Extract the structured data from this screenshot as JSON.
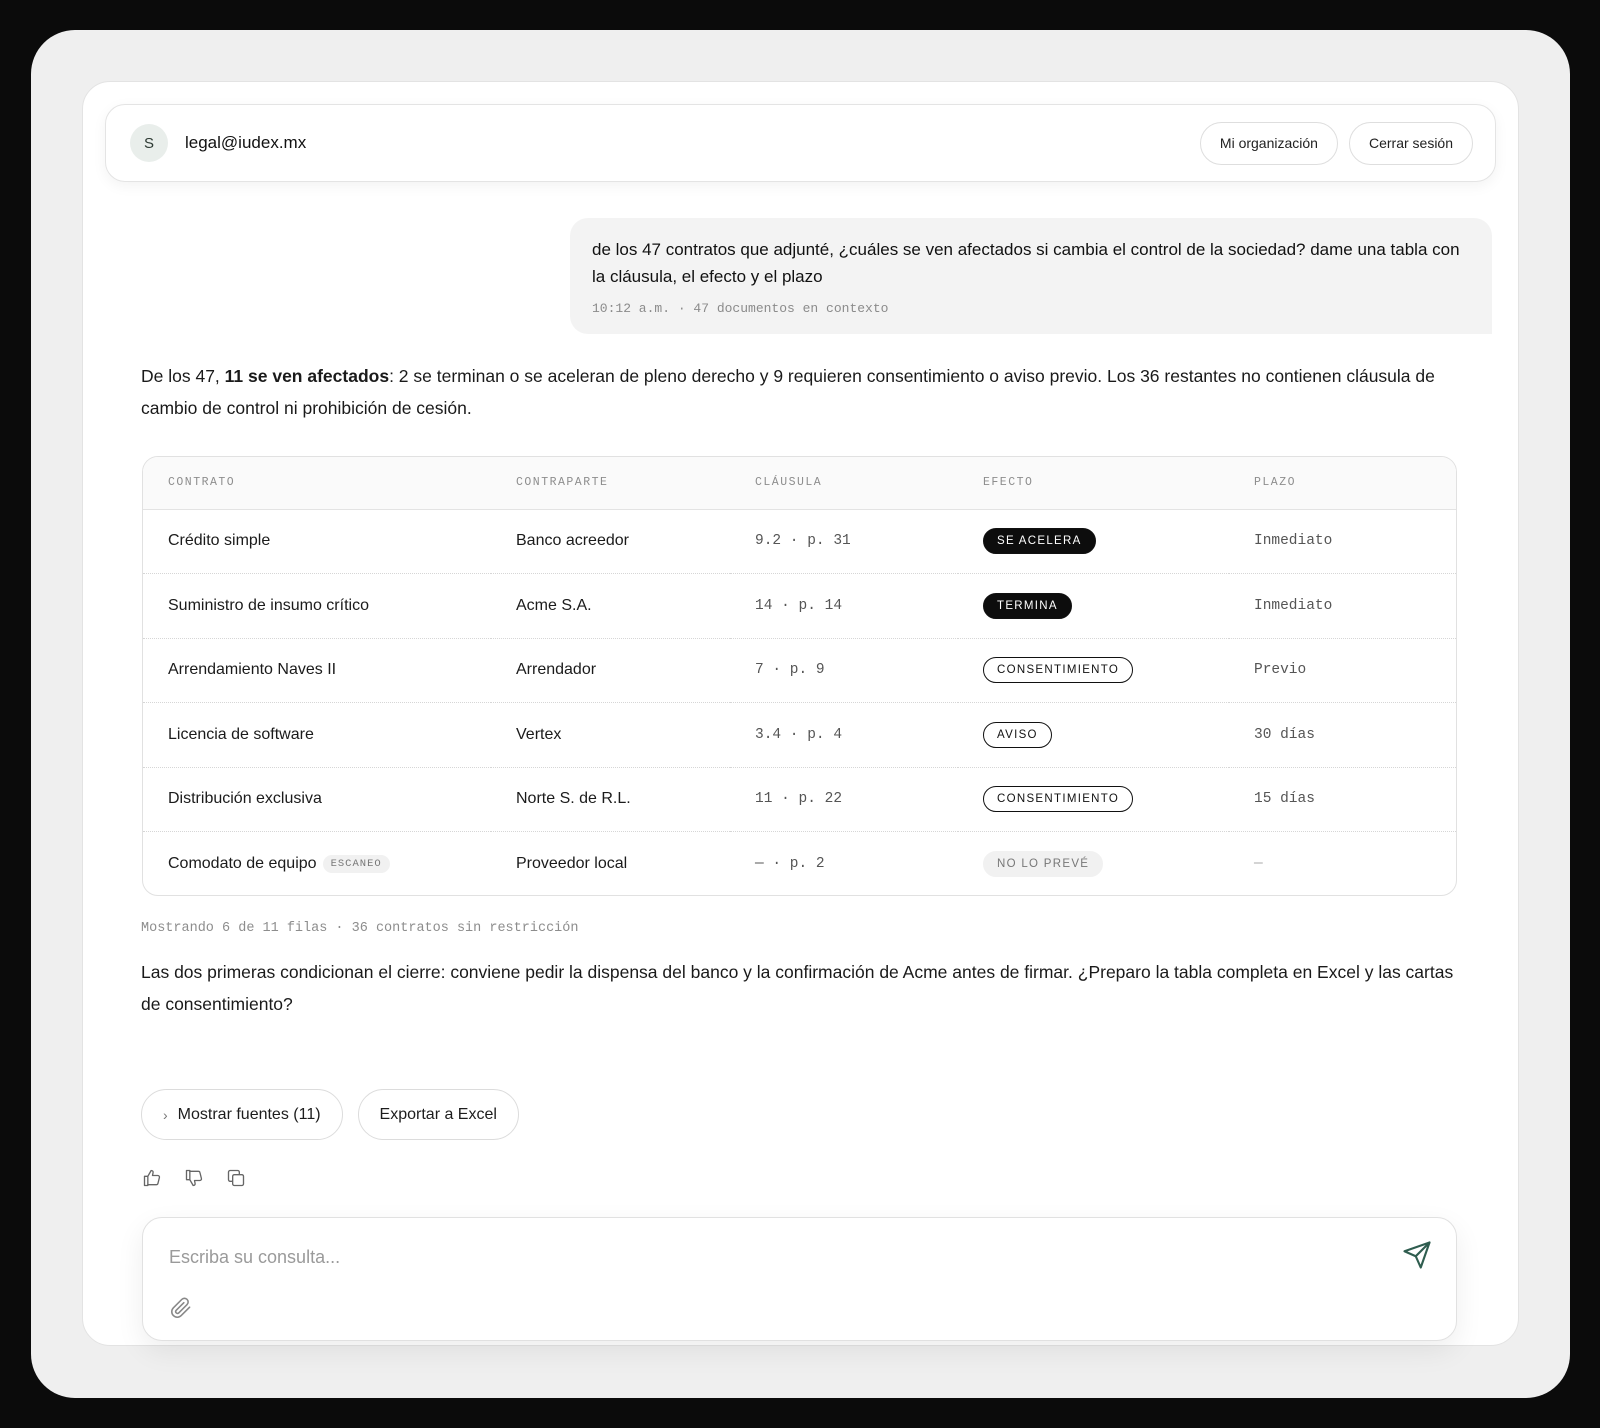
{
  "header": {
    "avatar_initial": "S",
    "email": "legal@iudex.mx",
    "org_button": "Mi organización",
    "logout_button": "Cerrar sesión"
  },
  "user_message": {
    "text": "de los 47 contratos que adjunté, ¿cuáles se ven afectados si cambia el control de la sociedad? dame una tabla con la cláusula, el efecto y el plazo",
    "meta": "10:12 a.m. · 47 documentos en contexto"
  },
  "assistant": {
    "intro_pre": "De los 47, ",
    "intro_bold": "11 se ven afectados",
    "intro_post": ": 2 se terminan o se aceleran de pleno derecho y 9 requieren consentimiento o aviso previo. Los 36 restantes no contienen cláusula de cambio de control ni prohibición de cesión.",
    "table": {
      "headers": [
        "CONTRATO",
        "CONTRAPARTE",
        "CLÁUSULA",
        "EFECTO",
        "PLAZO"
      ],
      "rows": [
        {
          "contrato": "Crédito simple",
          "tag": "",
          "contraparte": "Banco acreedor",
          "clausula": "9.2 · p. 31",
          "efecto": "SE ACELERA",
          "efecto_style": "solid",
          "plazo": "Inmediato"
        },
        {
          "contrato": "Suministro de insumo crítico",
          "tag": "",
          "contraparte": "Acme S.A.",
          "clausula": "14 · p. 14",
          "efecto": "TERMINA",
          "efecto_style": "solid",
          "plazo": "Inmediato"
        },
        {
          "contrato": "Arrendamiento Naves II",
          "tag": "",
          "contraparte": "Arrendador",
          "clausula": "7 · p. 9",
          "efecto": "CONSENTIMIENTO",
          "efecto_style": "outline",
          "plazo": "Previo"
        },
        {
          "contrato": "Licencia de software",
          "tag": "",
          "contraparte": "Vertex",
          "clausula": "3.4 · p. 4",
          "efecto": "AVISO",
          "efecto_style": "outline",
          "plazo": "30 días"
        },
        {
          "contrato": "Distribución exclusiva",
          "tag": "",
          "contraparte": "Norte S. de R.L.",
          "clausula": "11 · p. 22",
          "efecto": "CONSENTIMIENTO",
          "efecto_style": "outline",
          "plazo": "15 días"
        },
        {
          "contrato": "Comodato de equipo",
          "tag": "ESCANEO",
          "contraparte": "Proveedor local",
          "clausula": "— · p. 2",
          "efecto": "NO LO PREVÉ",
          "efecto_style": "muted",
          "plazo": "—"
        }
      ],
      "note": "Mostrando 6 de 11 filas · 36 contratos sin restricción"
    },
    "closing": "Las dos primeras condicionan el cierre: conviene pedir la dispensa del banco y la confirmación de Acme antes de firmar. ¿Preparo la tabla completa en Excel y las cartas de consentimiento?",
    "sources_button": "Mostrar fuentes (11)",
    "export_button": "Exportar a Excel"
  },
  "composer": {
    "placeholder": "Escriba su consulta...",
    "value": ""
  },
  "colors": {
    "accent": "#2f5d4f",
    "badge_solid": "#0d0d0d"
  },
  "icons": [
    "thumbs-up-icon",
    "thumbs-down-icon",
    "copy-icon",
    "send-icon",
    "paperclip-icon",
    "chevron-right-icon"
  ]
}
